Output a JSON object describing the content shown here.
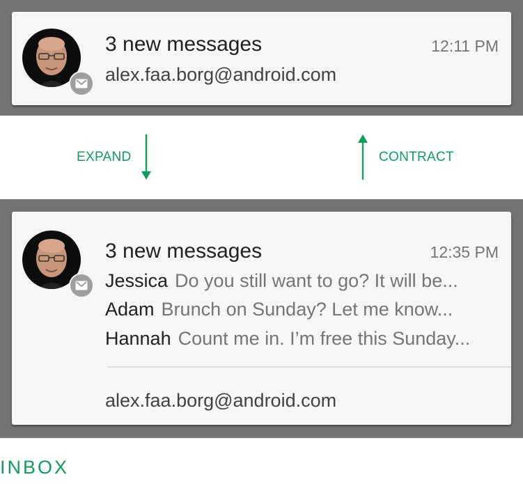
{
  "collapsed": {
    "title": "3 new messages",
    "time": "12:11 PM",
    "account": "alex.faa.borg@android.com"
  },
  "transitions": {
    "expand_label": "EXPAND",
    "contract_label": "CONTRACT"
  },
  "expanded": {
    "title": "3 new messages",
    "time": "12:35 PM",
    "messages": [
      {
        "sender": "Jessica",
        "preview": "Do you still want to go? It will be..."
      },
      {
        "sender": "Adam",
        "preview": "Brunch on Sunday? Let me know..."
      },
      {
        "sender": "Hannah",
        "preview": "Count me in. I’m free this Sunday..."
      }
    ],
    "account": "alex.faa.borg@android.com"
  },
  "style_label": "INBOX",
  "icons": {
    "badge": "gmail-icon",
    "expand": "arrow-down-icon",
    "contract": "arrow-up-icon"
  },
  "colors": {
    "accent": "#0f9d58",
    "shade": "#747474",
    "card": "#f6f6f6",
    "badge": "#9e9e9e"
  }
}
